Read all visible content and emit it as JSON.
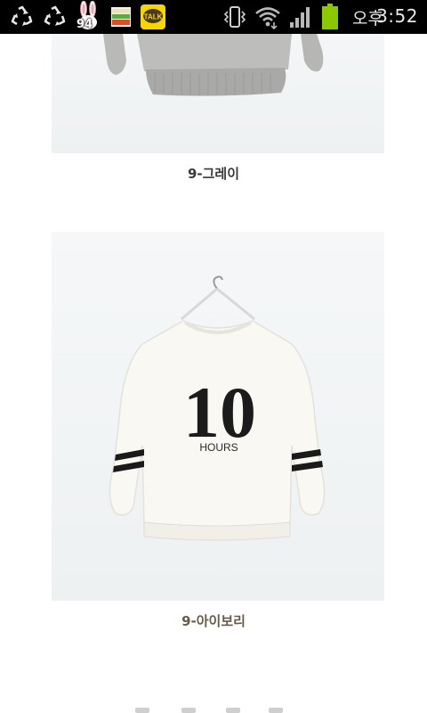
{
  "status_bar": {
    "notification_badge": "94",
    "ampm": "오후",
    "time": "3:52",
    "icons": [
      "recycle-icon",
      "recycle-icon",
      "rabbit-icon",
      "flag-icon",
      "kakaotalk-icon",
      "vibrate-icon",
      "wifi-icon",
      "signal-icon",
      "battery-icon"
    ],
    "talk_label": "TALK",
    "battery_color": "#8cc800"
  },
  "products": [
    {
      "caption": "9-그레이",
      "color": "#3a3a3a"
    },
    {
      "caption": "9-아이보리",
      "color": "#6b5a45"
    }
  ],
  "sweatshirt": {
    "number": "10",
    "word": "HOURS"
  }
}
